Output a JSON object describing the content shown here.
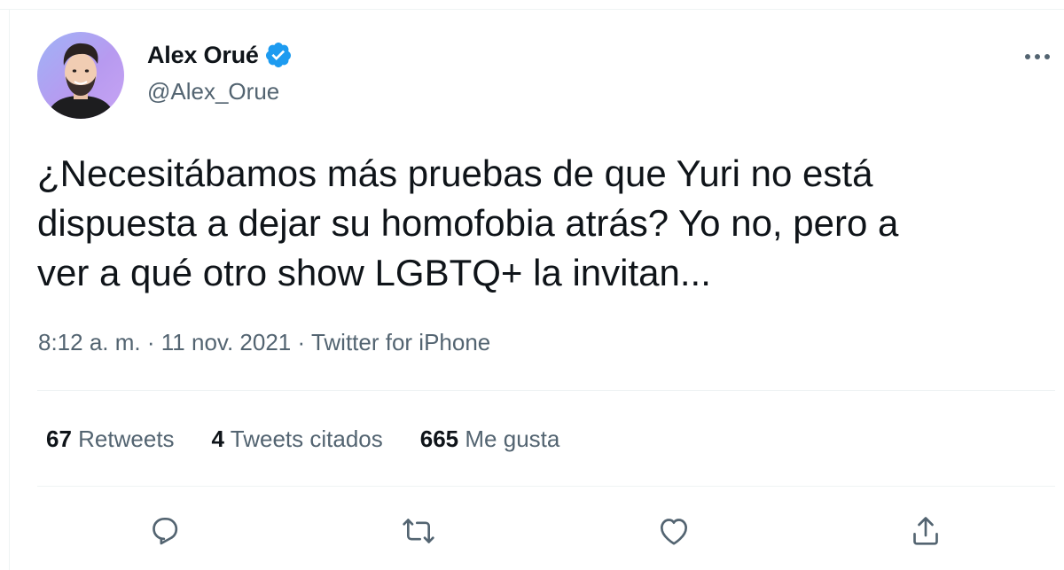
{
  "tweet": {
    "author": {
      "name": "Alex Orué",
      "handle": "@Alex_Orue",
      "verified_icon": "verified-badge-icon",
      "avatar": "avatar-photo"
    },
    "text_lines": [
      "¿Necesitábamos más pruebas de que Yuri no está",
      "dispuesta a dejar su homofobia atrás? Yo no, pero a",
      "ver a qué otro show LGBTQ+ la invitan..."
    ],
    "time": "8:12 a. m.",
    "separator": "·",
    "date": "11 nov. 2021",
    "source": "Twitter for iPhone",
    "stats": {
      "retweets": {
        "count": "67",
        "label": "Retweets"
      },
      "quotes": {
        "count": "4",
        "label": "Tweets citados"
      },
      "likes": {
        "count": "665",
        "label": "Me gusta"
      }
    },
    "actions": [
      "reply-icon",
      "retweet-icon",
      "like-icon",
      "share-icon"
    ],
    "more_icon": "more-options-icon"
  },
  "colors": {
    "text_primary": "#0f1419",
    "text_secondary": "#536471",
    "verified": "#1d9bf0",
    "divider": "#eff3f4",
    "icon": "#536471"
  }
}
